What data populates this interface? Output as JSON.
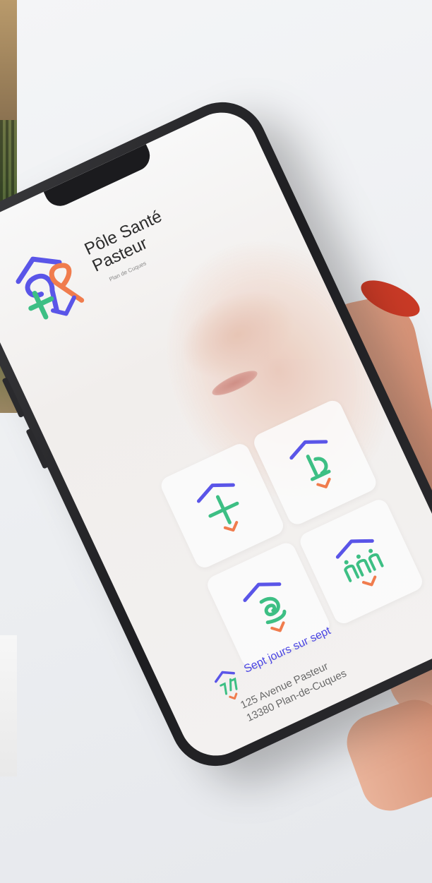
{
  "brand": {
    "name_line1": "Pôle Santé",
    "name_line2": "Pasteur",
    "subtitle": "Plan de Cuques"
  },
  "tiles": [
    {
      "icon": "cross-icon"
    },
    {
      "icon": "microscope-icon"
    },
    {
      "icon": "spiral-icon"
    },
    {
      "icon": "people-icon"
    }
  ],
  "footer": {
    "tagline": "Sept jours sur sept",
    "address_line1": "125 Avenue Pasteur",
    "address_line2": "13380 Plan-de-Cuques"
  },
  "colors": {
    "blue": "#5a55e8",
    "green": "#3dbf84",
    "orange": "#f07c4d",
    "nail": "#c93a26"
  }
}
